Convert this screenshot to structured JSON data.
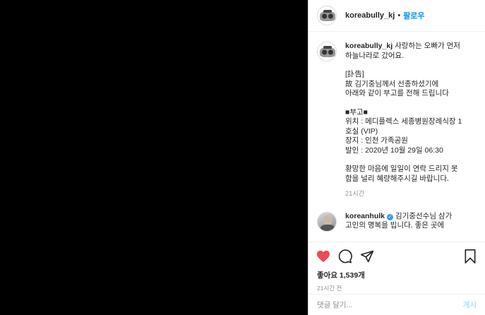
{
  "post": {
    "username": "koreabully_kj",
    "separator": "•",
    "follow_label": "팔로우"
  },
  "caption": {
    "username": "koreabully_kj",
    "line1": "사랑하는 오빠가 먼저",
    "line2": "하늘나라로 갔어요.",
    "block1": "[訃告]\n故 김기중님께서 선종하셨기에\n아래와 같이 부고를 전해 드립니다",
    "block2": "■부고■\n위치 : 메디플렉스 세종병원장례식장 1\n호실 (VIP)\n장지 : 인천 가족공원\n발인 : 2020년 10월 29일 06:30",
    "block3": "황망한 마음에 일일이 연락 드리지 못\n함을 널리 혜량해주시길 바랍니다.",
    "time": "21시간"
  },
  "comment": {
    "username": "koreanhulk",
    "verified_icon": "verified-badge-icon",
    "text_line1": "김기중선수님 삼가",
    "text_line2": "고인의 명복을 빕니다. 좋은 곳에"
  },
  "actions": {
    "like_icon": "heart-icon",
    "comment_icon": "comment-icon",
    "share_icon": "share-icon",
    "save_icon": "bookmark-icon",
    "like_color": "#ed4956"
  },
  "likes_text": "좋아요 1,539개",
  "post_time": "21시간 전",
  "comment_input": {
    "placeholder": "댓글 달기...",
    "post_label": "게시"
  },
  "colors": {
    "accent": "#0095f6",
    "text": "#262626",
    "muted": "#8e8e8e"
  }
}
